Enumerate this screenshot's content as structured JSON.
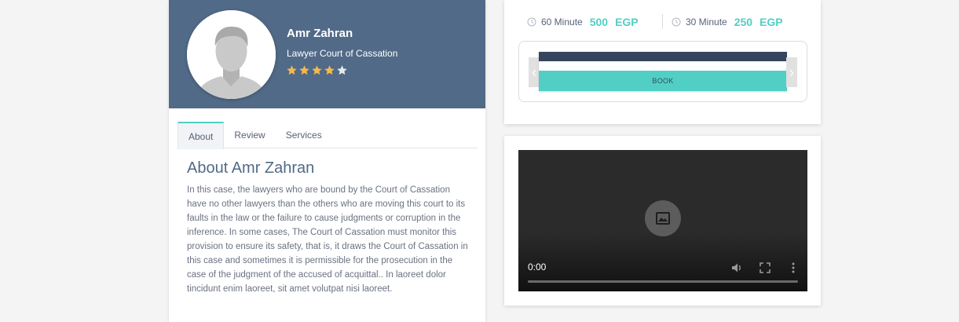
{
  "profile": {
    "name": "Amr Zahran",
    "title": "Lawyer Court of Cassation",
    "rating": 4,
    "rating_max": 5,
    "header_color": "#516a87",
    "star_color": "#f7b84b"
  },
  "tabs": [
    {
      "label": "About",
      "active": true
    },
    {
      "label": "Review",
      "active": false
    },
    {
      "label": "Services",
      "active": false
    }
  ],
  "about": {
    "heading": "About Amr Zahran",
    "text": "In this case, the lawyers who are bound by the Court of Cassation have no other lawyers than the others who are moving this court to its faults in the law or the failure to cause judgments or corruption in the inference. In some cases, The Court of Cassation must monitor this provision to ensure its safety, that is, it draws the Court of Cassation in this case and sometimes it is permissible for the prosecution in the case of the judgment of the accused of acquittal.. In laoreet dolor tincidunt enim laoreet, sit amet volutpat nisi laoreet."
  },
  "pricing": [
    {
      "label": "60 Minute",
      "amount": "500",
      "currency": "EGP",
      "icon": "clock-icon"
    },
    {
      "label": "30 Minute",
      "amount": "250",
      "currency": "EGP",
      "icon": "clock-icon"
    }
  ],
  "booking": {
    "button_label": "BOOK",
    "accent": "#51cfc4",
    "prev_icon": "chevron-left-icon",
    "next_icon": "chevron-right-icon"
  },
  "video": {
    "time": "0:00",
    "icons": [
      "broken-image-icon",
      "volume-icon",
      "fullscreen-icon",
      "more-vert-icon"
    ]
  }
}
